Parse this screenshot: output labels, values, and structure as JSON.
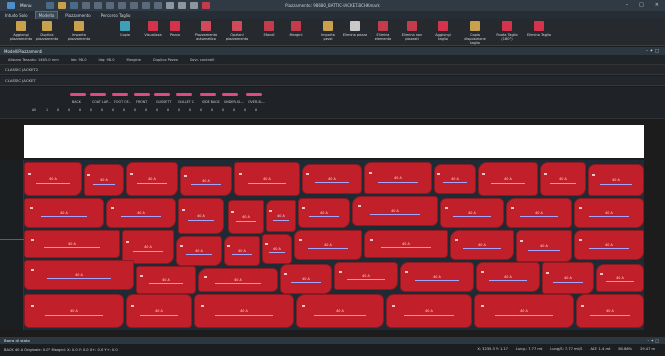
{
  "titlebar": {
    "menu_label": "Menu",
    "title": "Piazzamento: 98680_BATTIC-IACKET.BCHKmark"
  },
  "tabs": [
    "Intudo Solo",
    "Modella",
    "Piazzamento",
    "Percorso Taglio"
  ],
  "ribbon": [
    {
      "label": "Aggiungi\npiazzamento",
      "color": "#c9a14a"
    },
    {
      "label": "Duplica\npiazzamento",
      "color": "#c9a14a"
    },
    {
      "label": "Importa\npiazzamento",
      "color": "#c9a14a"
    },
    {
      "label": "Copia",
      "color": "#3f9fb8"
    },
    {
      "label": "Visualizza",
      "color": "#d6324b"
    },
    {
      "label": "Pezzo",
      "color": "#d6324b"
    },
    {
      "label": "Piazzamento\nautomatico",
      "color": "#d04a5a"
    },
    {
      "label": "Opzioni\npiazzamento",
      "color": "#d04a5a"
    },
    {
      "label": "Sfondi",
      "color": "#c43c4b"
    },
    {
      "label": "Margini",
      "color": "#c43c4b"
    },
    {
      "label": "Importa\npezzi",
      "color": "#c9a14a"
    },
    {
      "label": "Elimina pezzo",
      "color": "#c9c9c9"
    },
    {
      "label": "Elimina\nelemento",
      "color": "#c43c4b"
    },
    {
      "label": "Elimina non\npiazzati",
      "color": "#c43c4b"
    },
    {
      "label": "Aggiungi\ntaglio",
      "color": "#d6324b"
    },
    {
      "label": "Copia disposizione\ntaglio",
      "color": "#c9a14a"
    },
    {
      "label": "Ruota Taglio\n(180°)",
      "color": "#d6324b"
    },
    {
      "label": "Elimina Taglio",
      "color": "#d6324b"
    }
  ],
  "panel": {
    "title": "ModelliPiazzamenti",
    "info": [
      "Altezza Tessuto: 1465.0 mm",
      "Idx: 98.0",
      "Idq: 98.0",
      "Margine",
      "Duplica Pezzo",
      "Sovr. controlli"
    ],
    "rows": [
      "CLASSIC JACKET2",
      "CLASSIC JACKET"
    ]
  },
  "piece_table": {
    "headers": [
      "Pezzo",
      "BACK",
      "COAT LAP...",
      "FOOT OF...",
      "FRONT",
      "GUSSETT",
      "GULLET C",
      "SIDE BACK",
      "UNDER-SL...",
      "OVER-SL..."
    ],
    "row_label": "All",
    "row_values": [
      "1",
      "0",
      "0",
      "0",
      "0",
      "0",
      "0",
      "0",
      "0",
      "0",
      "0",
      "0",
      "0",
      "0",
      "0",
      "0",
      "0",
      "0",
      "0",
      "0"
    ]
  },
  "piece_label": "40 A",
  "status": {
    "panel_title": "Barra di stato",
    "left": "BACK 40 A  Originale: 0.0°  Margini: X: 0.0  Y: 0.0  X+: 0.0  Y+: 0.0",
    "right": [
      "X: 3235.3  Y: 1.17",
      "Lung.: 7.77 mt",
      "Lung/S: 7.77 mt/S",
      "ALT: 1.4 mt",
      "80.86%",
      "29.47 m"
    ]
  }
}
